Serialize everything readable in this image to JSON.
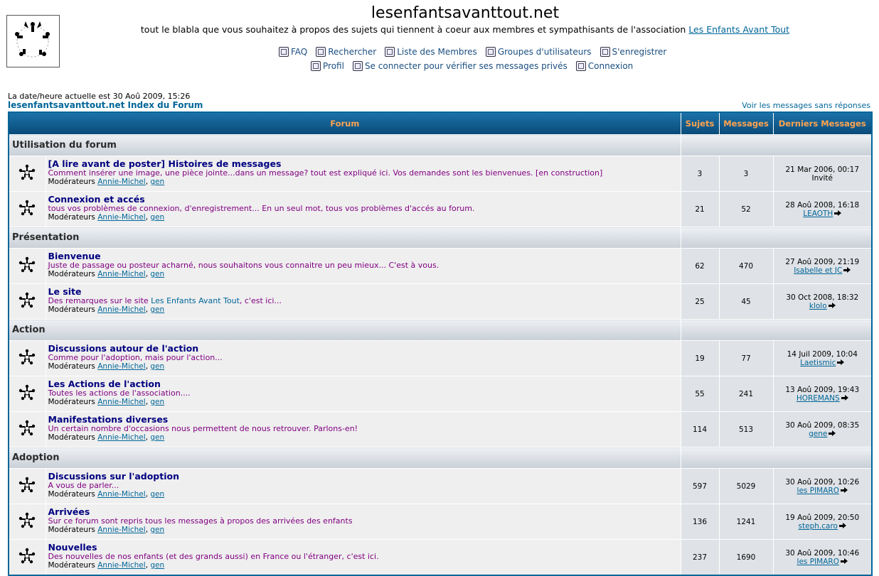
{
  "header": {
    "site_title": "lesenfantsavanttout.net",
    "description_prefix": "tout le blabla que vous souhaitez à propos des sujets qui tiennent à coeur aux membres et sympathisants de l'association",
    "description_link": "Les Enfants Avant Tout",
    "nav_row1": [
      {
        "label": "FAQ",
        "icon": "faq-icon"
      },
      {
        "label": "Rechercher",
        "icon": "search-icon"
      },
      {
        "label": "Liste des Membres",
        "icon": "memberlist-icon"
      },
      {
        "label": "Groupes d'utilisateurs",
        "icon": "usergroups-icon"
      },
      {
        "label": "S'enregistrer",
        "icon": "register-icon"
      }
    ],
    "nav_row2": [
      {
        "label": "Profil",
        "icon": "profile-icon"
      },
      {
        "label": "Se connecter pour vérifier ses messages privés",
        "icon": "private-messages-icon"
      },
      {
        "label": "Connexion",
        "icon": "login-icon"
      }
    ]
  },
  "datetime": "La date/heure actuelle est 30 Aoû 2009, 15:26",
  "breadcrumb": "lesenfantsavanttout.net Index du Forum",
  "unanswered_link": "Voir les messages sans réponses",
  "table": {
    "headers": {
      "forum": "Forum",
      "topics": "Sujets",
      "posts": "Messages",
      "last": "Derniers Messages"
    },
    "moderators_label": "Modérateurs",
    "moderators": [
      "Annie-Michel",
      "gen"
    ],
    "categories": [
      {
        "name": "Utilisation du forum",
        "forums": [
          {
            "name": "[A lire avant de poster] Histoires de messages",
            "desc": "Comment insérer une image, une pièce jointe...dans un message? tout est expliqué ici. Vos demandes sont les bienvenues. [en construction]",
            "topics": "3",
            "posts": "3",
            "last_date": "21 Mar 2006, 00:17",
            "last_user": "Invité",
            "user_linked": false
          },
          {
            "name": "Connexion et accés",
            "desc": "tous vos problèmes de connexion, d'enregistrement... En un seul mot, tous vos problèmes d'accés au forum.",
            "topics": "21",
            "posts": "52",
            "last_date": "28 Aoû 2008, 16:18",
            "last_user": "LEAOTH",
            "user_linked": true
          }
        ]
      },
      {
        "name": "Présentation",
        "forums": [
          {
            "name": "Bienvenue",
            "desc": "Juste de passage ou posteur acharné, nous souhaitons vous connaitre un peu mieux... C'est à vous.",
            "topics": "62",
            "posts": "470",
            "last_date": "27 Aoû 2009, 21:19",
            "last_user": "Isabelle et JC",
            "user_linked": true
          },
          {
            "name": "Le site",
            "desc_prefix": "Des remarques sur le site ",
            "desc_link": "Les Enfants Avant Tout",
            "desc_suffix": ", c'est ici...",
            "topics": "25",
            "posts": "45",
            "last_date": "30 Oct 2008, 18:32",
            "last_user": "klolo",
            "user_linked": true
          }
        ]
      },
      {
        "name": "Action",
        "forums": [
          {
            "name": "Discussions autour de l'action",
            "desc": "Comme pour l'adoption, mais pour l'action...",
            "topics": "19",
            "posts": "77",
            "last_date": "14 Juil 2009, 10:04",
            "last_user": "Laetismic",
            "user_linked": true
          },
          {
            "name": "Les Actions de l'action",
            "desc": "Toutes les actions de l'association....",
            "topics": "55",
            "posts": "241",
            "last_date": "13 Aoû 2009, 19:43",
            "last_user": "HOREMANS",
            "user_linked": true
          },
          {
            "name": "Manifestations diverses",
            "desc": "Un certain nombre d'occasions nous permettent de nous retrouver. Parlons-en!",
            "topics": "114",
            "posts": "513",
            "last_date": "30 Aoû 2009, 08:35",
            "last_user": "gene",
            "user_linked": true
          }
        ]
      },
      {
        "name": "Adoption",
        "forums": [
          {
            "name": "Discussions sur l'adoption",
            "desc": "A vous de parler...",
            "topics": "597",
            "posts": "5029",
            "last_date": "30 Aoû 2009, 10:26",
            "last_user": "les PIMARO",
            "user_linked": true
          },
          {
            "name": "Arrivées",
            "desc": "Sur ce forum sont repris tous les messages à propos des arrivées des enfants",
            "topics": "136",
            "posts": "1241",
            "last_date": "19 Aoû 2009, 20:50",
            "last_user": "steph.caro",
            "user_linked": true
          },
          {
            "name": "Nouvelles",
            "desc": "Des nouvelles de nos enfants (et des grands aussi) en France ou l'étranger, c'est ici.",
            "topics": "237",
            "posts": "1690",
            "last_date": "30 Aoû 2009, 10:46",
            "last_user": "les PIMARO",
            "user_linked": true
          }
        ]
      }
    ]
  }
}
